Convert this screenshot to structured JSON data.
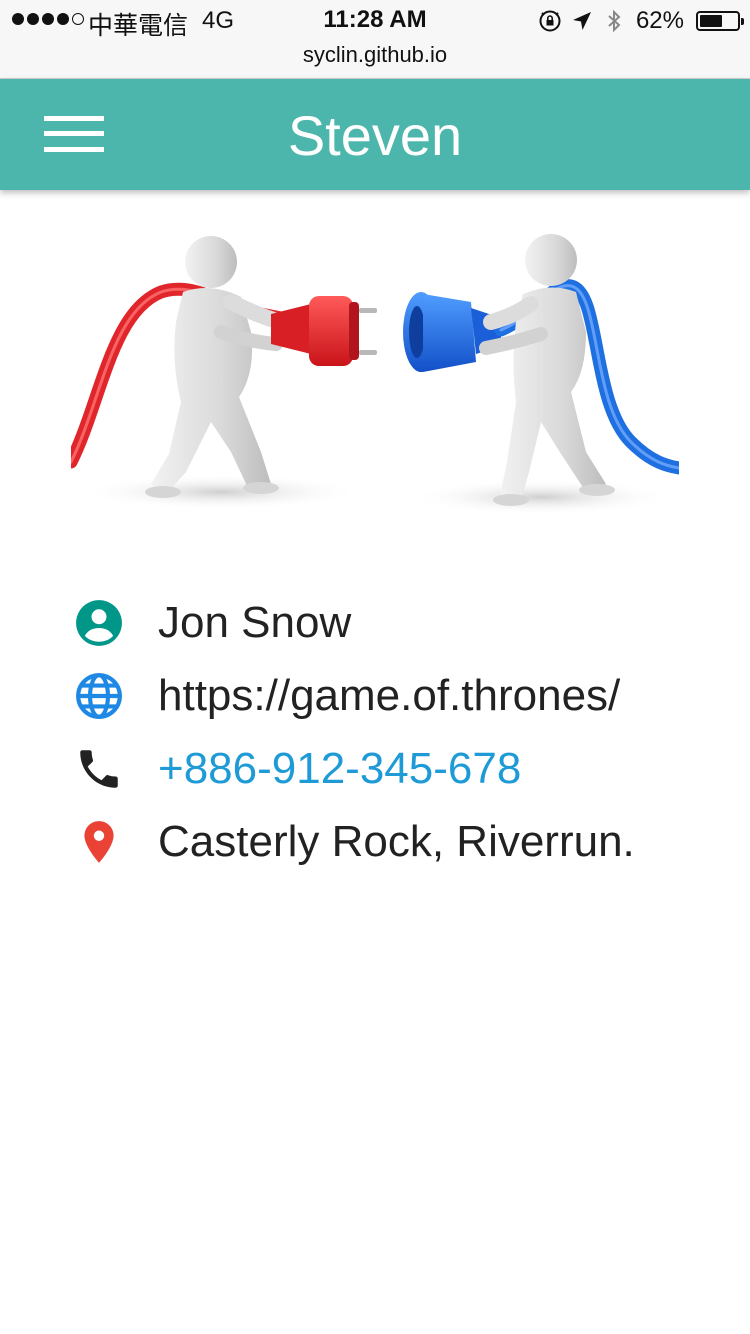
{
  "status_bar": {
    "carrier": "中華電信",
    "network": "4G",
    "time": "11:28 AM",
    "battery_percent": "62%",
    "battery_level": 0.62,
    "signal_bars_filled": 4,
    "signal_bars_total": 5,
    "icons": [
      "orientation-lock-icon",
      "location-arrow-icon",
      "bluetooth-icon",
      "battery-icon"
    ]
  },
  "browser": {
    "url": "syclin.github.io"
  },
  "app_bar": {
    "title": "Steven",
    "menu_icon": "hamburger-menu-icon",
    "color": "#4db6ac"
  },
  "hero": {
    "illustration": "two-figures-plug-socket"
  },
  "contacts": [
    {
      "icon": "account-circle-icon",
      "icon_color": "#009688",
      "text": "Jon Snow"
    },
    {
      "icon": "globe-icon",
      "icon_color": "#1e88e5",
      "text": "https://game.of.thrones/"
    },
    {
      "icon": "phone-icon",
      "icon_color": "#222222",
      "text": "+886-912-345-678",
      "text_color": "#1e9bd7"
    },
    {
      "icon": "map-pin-icon",
      "icon_color": "#ea4335",
      "text": "Casterly Rock, Riverrun."
    }
  ]
}
